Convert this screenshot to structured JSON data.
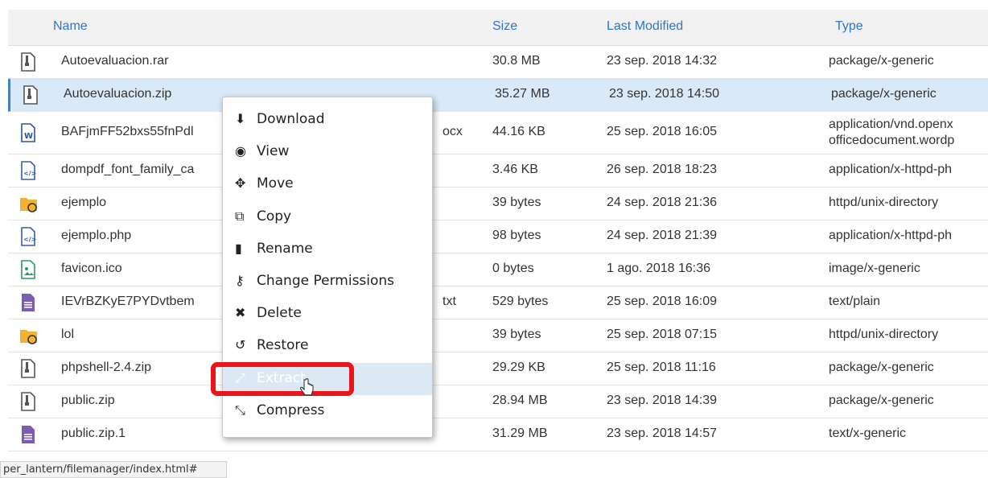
{
  "columns": {
    "name": "Name",
    "size": "Size",
    "modified": "Last Modified",
    "type": "Type"
  },
  "files": [
    {
      "icon": "archive-icon",
      "name": "Autoevaluacion.rar",
      "size": "30.8 MB",
      "modified": "23 sep. 2018 14:32",
      "type": "package/x-generic"
    },
    {
      "icon": "archive-icon",
      "name": "Autoevaluacion.zip",
      "size": "35.27 MB",
      "modified": "23 sep. 2018 14:50",
      "type": "package/x-generic",
      "selected": true
    },
    {
      "icon": "word-doc-icon",
      "name": "BAFjmFF52bxs55fnPdl",
      "name_tail": "ocx",
      "size": "44.16 KB",
      "modified": "25 sep. 2018 16:05",
      "type": "application/vnd.openx officedocument.wordp"
    },
    {
      "icon": "code-file-icon",
      "name": "dompdf_font_family_ca",
      "size": "3.46 KB",
      "modified": "26 sep. 2018 18:23",
      "type": "application/x-httpd-ph"
    },
    {
      "icon": "folder-link-icon",
      "name": "ejemplo",
      "size": "39 bytes",
      "modified": "24 sep. 2018 21:36",
      "type": "httpd/unix-directory"
    },
    {
      "icon": "code-file-icon",
      "name": "ejemplo.php",
      "size": "98 bytes",
      "modified": "24 sep. 2018 21:39",
      "type": "application/x-httpd-ph"
    },
    {
      "icon": "image-file-icon",
      "name": "favicon.ico",
      "size": "0 bytes",
      "modified": "1 ago. 2018 16:36",
      "type": "image/x-generic"
    },
    {
      "icon": "text-file-icon",
      "name": "IEVrBZKyE7PYDvtbem",
      "name_tail": "txt",
      "size": "529 bytes",
      "modified": "25 sep. 2018 16:09",
      "type": "text/plain"
    },
    {
      "icon": "folder-link-icon",
      "name": "lol",
      "size": "39 bytes",
      "modified": "25 sep. 2018 07:15",
      "type": "httpd/unix-directory"
    },
    {
      "icon": "archive-icon",
      "name": "phpshell-2.4.zip",
      "size": "29.29 KB",
      "modified": "25 sep. 2018 11:16",
      "type": "package/x-generic"
    },
    {
      "icon": "archive-icon",
      "name": "public.zip",
      "size": "28.94 MB",
      "modified": "23 sep. 2018 14:39",
      "type": "package/x-generic"
    },
    {
      "icon": "text-file-icon",
      "name": "public.zip.1",
      "size": "31.29 MB",
      "modified": "23 sep. 2018 14:57",
      "type": "text/x-generic"
    }
  ],
  "context_menu": [
    {
      "icon": "download-icon",
      "glyph": "⬇",
      "label": "Download"
    },
    {
      "icon": "eye-icon",
      "glyph": "◉",
      "label": "View"
    },
    {
      "icon": "move-icon",
      "glyph": "✥",
      "label": "Move"
    },
    {
      "icon": "copy-icon",
      "glyph": "⧉",
      "label": "Copy"
    },
    {
      "icon": "file-icon",
      "glyph": "▮",
      "label": "Rename"
    },
    {
      "icon": "key-icon",
      "glyph": "⚷",
      "label": "Change Permissions"
    },
    {
      "icon": "times-icon",
      "glyph": "✖",
      "label": "Delete"
    },
    {
      "icon": "undo-icon",
      "glyph": "↺",
      "label": "Restore"
    },
    {
      "icon": "expand-icon",
      "glyph": "⤢",
      "label": "Extract",
      "highlighted": true
    },
    {
      "icon": "compress-icon",
      "glyph": "⤡",
      "label": "Compress"
    }
  ],
  "status_url": "per_lantern/filemanager/index.html#",
  "colors": {
    "accent": "#2f76c6",
    "selected_row": "#d9e9f8",
    "callout": "#e8151b"
  }
}
